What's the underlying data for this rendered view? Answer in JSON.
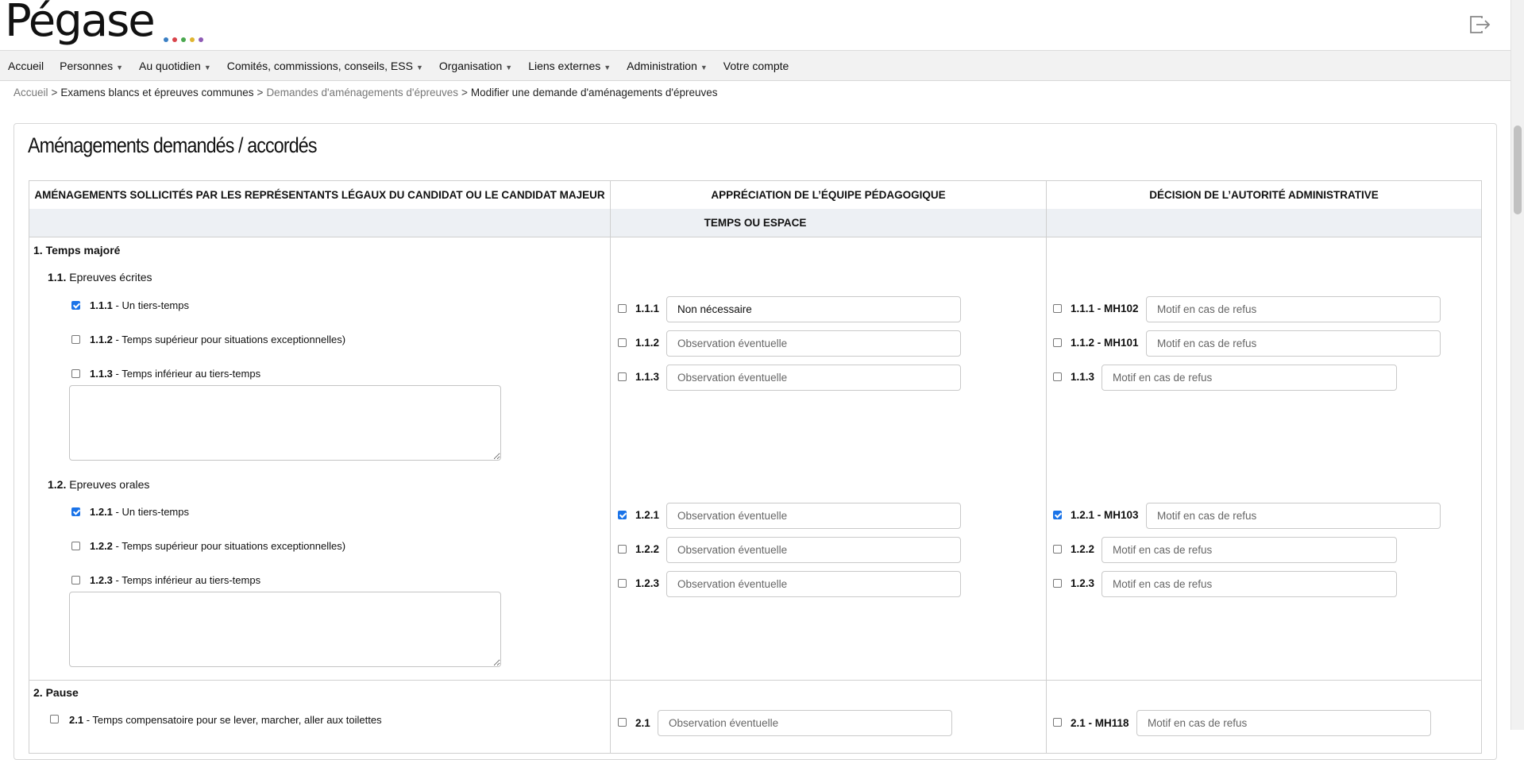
{
  "app": {
    "logo_text": "Pégase",
    "logo_dots": [
      "#3a7fc4",
      "#d9444b",
      "#4aa84f",
      "#e0b530",
      "#8e5ab5"
    ]
  },
  "nav": [
    {
      "label": "Accueil",
      "dropdown": false
    },
    {
      "label": "Personnes",
      "dropdown": true
    },
    {
      "label": "Au quotidien",
      "dropdown": true
    },
    {
      "label": "Comités, commissions, conseils, ESS",
      "dropdown": true
    },
    {
      "label": "Organisation",
      "dropdown": true
    },
    {
      "label": "Liens externes",
      "dropdown": true
    },
    {
      "label": "Administration",
      "dropdown": true
    },
    {
      "label": "Votre compte",
      "dropdown": false
    }
  ],
  "breadcrumb": {
    "home": "Accueil",
    "level1": "Examens blancs et épreuves communes",
    "level2": "Demandes d'aménagements d'épreuves",
    "current": "Modifier une demande d'aménagements d'épreuves",
    "sep": ">"
  },
  "page": {
    "title": "Aménagements demandés / accordés"
  },
  "table": {
    "headers": [
      "AMÉNAGEMENTS SOLLICITÉS PAR LES REPRÉSENTANTS LÉGAUX DU CANDIDAT OU LE CANDIDAT MAJEUR",
      "APPRÉCIATION DE L’ÉQUIPE PÉDAGOGIQUE",
      "DÉCISION DE L’AUTORITÉ ADMINISTRATIVE"
    ],
    "section": "TEMPS OU ESPACE",
    "group1": {
      "title": "1. Temps majoré",
      "sub1": {
        "num": "1.1.",
        "label": "Epreuves écrites",
        "items": [
          {
            "code": "1.1.1",
            "text": " - Un tiers-temps",
            "checked": true,
            "eq_code": "1.1.1",
            "eq_checked": false,
            "eq_value": "Non nécessaire",
            "eq_placeholder": "Observation éventuelle",
            "dec_code": "1.1.1 - MH102",
            "dec_checked": false,
            "dec_placeholder": "Motif en cas de refus"
          },
          {
            "code": "1.1.2",
            "text": " - Temps supérieur pour situations exceptionnelles)",
            "checked": false,
            "eq_code": "1.1.2",
            "eq_checked": false,
            "eq_value": "",
            "eq_placeholder": "Observation éventuelle",
            "dec_code": "1.1.2 - MH101",
            "dec_checked": false,
            "dec_placeholder": "Motif en cas de refus"
          },
          {
            "code": "1.1.3",
            "text": " - Temps inférieur au tiers-temps",
            "checked": false,
            "eq_code": "1.1.3",
            "eq_checked": false,
            "eq_value": "",
            "eq_placeholder": "Observation éventuelle",
            "dec_code": "1.1.3",
            "dec_checked": false,
            "dec_placeholder": "Motif en cas de refus"
          }
        ]
      },
      "sub2": {
        "num": "1.2.",
        "label": "Epreuves orales",
        "items": [
          {
            "code": "1.2.1",
            "text": " - Un tiers-temps",
            "checked": true,
            "eq_code": "1.2.1",
            "eq_checked": true,
            "eq_value": "",
            "eq_placeholder": "Observation éventuelle",
            "dec_code": "1.2.1 - MH103",
            "dec_checked": true,
            "dec_placeholder": "Motif en cas de refus"
          },
          {
            "code": "1.2.2",
            "text": " - Temps supérieur pour situations exceptionnelles)",
            "checked": false,
            "eq_code": "1.2.2",
            "eq_checked": false,
            "eq_value": "",
            "eq_placeholder": "Observation éventuelle",
            "dec_code": "1.2.2",
            "dec_checked": false,
            "dec_placeholder": "Motif en cas de refus"
          },
          {
            "code": "1.2.3",
            "text": " - Temps inférieur au tiers-temps",
            "checked": false,
            "eq_code": "1.2.3",
            "eq_checked": false,
            "eq_value": "",
            "eq_placeholder": "Observation éventuelle",
            "dec_code": "1.2.3",
            "dec_checked": false,
            "dec_placeholder": "Motif en cas de refus"
          }
        ]
      }
    },
    "group2": {
      "title": "2. Pause",
      "item": {
        "code": "2.1",
        "text": " - Temps compensatoire pour se lever, marcher, aller aux toilettes",
        "checked": false,
        "eq_code": "2.1",
        "eq_checked": false,
        "eq_placeholder": "Observation éventuelle",
        "dec_code": "2.1 - MH118",
        "dec_checked": false,
        "dec_placeholder": "Motif en cas de refus"
      }
    }
  }
}
